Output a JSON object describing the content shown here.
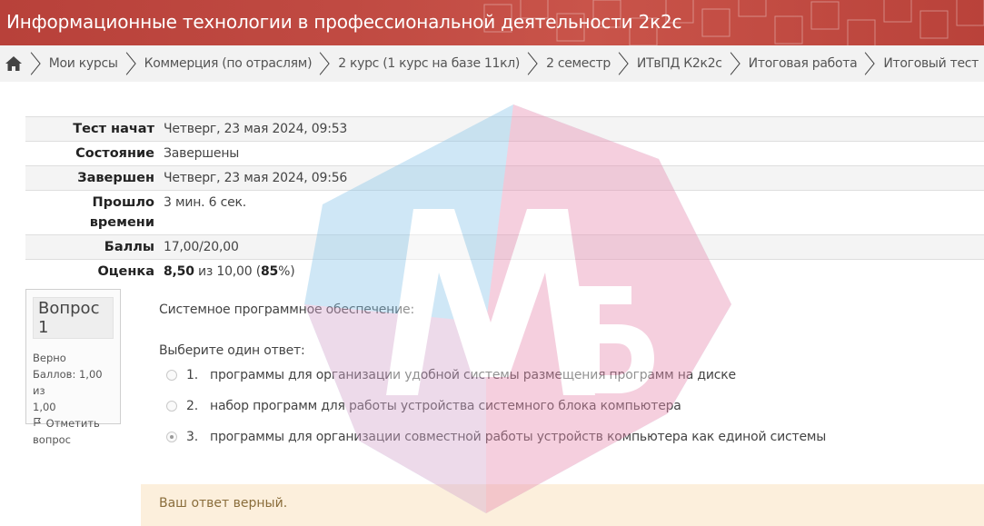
{
  "header": {
    "title": "Информационные технологии в профессиональной деятельности 2к2с"
  },
  "breadcrumb": {
    "home_icon": "home-icon",
    "items": [
      {
        "label": "Мои курсы"
      },
      {
        "label": "Коммерция (по отраслям)"
      },
      {
        "label": "2 курс (1 курс на базе 11кл)"
      },
      {
        "label": "2 семестр"
      },
      {
        "label": "ИТвПД К2к2с"
      },
      {
        "label": "Итоговая работа"
      },
      {
        "label": "Итоговый тест"
      }
    ]
  },
  "summary": {
    "started_label": "Тест начат",
    "started_value": "Четверг, 23 мая 2024, 09:53",
    "state_label": "Состояние",
    "state_value": "Завершены",
    "finished_label": "Завершен",
    "finished_value": "Четверг, 23 мая 2024, 09:56",
    "elapsed_label_1": "Прошло",
    "elapsed_label_2": "времени",
    "elapsed_value": "3 мин. 6 сек.",
    "marks_label": "Баллы",
    "marks_value": "17,00/20,00",
    "grade_label": "Оценка",
    "grade_value": "8,50",
    "grade_of": " из 10,00 (",
    "grade_percent": "85",
    "grade_tail": "%)"
  },
  "question": {
    "label_word": "Вопрос",
    "number": "1",
    "state": "Верно",
    "marks_line_1": "Баллов: 1,00 из",
    "marks_line_2": "1,00",
    "flag_label_1": "Отметить",
    "flag_label_2": "вопрос",
    "text": "Системное программное обеспечение:",
    "prompt": "Выберите один ответ:",
    "answers": [
      {
        "num": "1.",
        "text": "программы для организации удобной системы размещения программ на диске",
        "checked": false
      },
      {
        "num": "2.",
        "text": "набор программ для работы устройства системного блока компьютера",
        "checked": false
      },
      {
        "num": "3.",
        "text": "программы для организации совместной работы устройств компьютера как единой системы",
        "checked": true
      }
    ],
    "feedback": "Ваш ответ верный."
  },
  "colors": {
    "banner": "#c04a42",
    "breadcrumb_bg": "#f2f2f2",
    "feedback_bg": "#fcefdc",
    "watermark_blue": "#8ec8ea",
    "watermark_pink": "#e88fb3"
  }
}
